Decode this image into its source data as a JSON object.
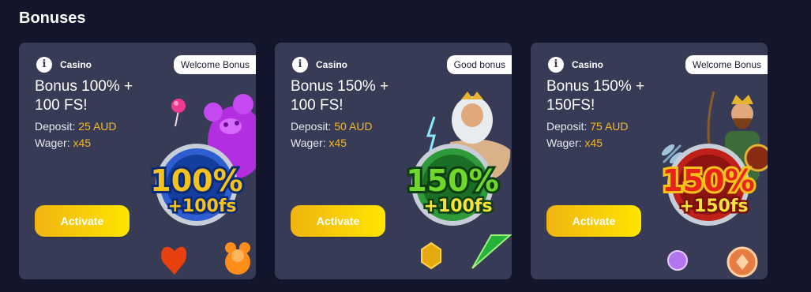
{
  "page": {
    "title": "Bonuses"
  },
  "labels": {
    "deposit": "Deposit: ",
    "wager": "Wager: "
  },
  "cards": [
    {
      "category": "Casino",
      "badge": "Welcome Bonus",
      "title": "Bonus 100% + 100 FS!",
      "deposit": "25 AUD",
      "wager": "x45",
      "button": "Activate",
      "coin_percent": "100%",
      "coin_fs": "+100fs",
      "coin_percent_color": "#f6c21b",
      "coin_ring_color": "#2d5fd0"
    },
    {
      "category": "Casino",
      "badge": "Good bonus",
      "title": "Bonus 150% + 100 FS!",
      "deposit": "50 AUD",
      "wager": "x45",
      "button": "Activate",
      "coin_percent": "150%",
      "coin_fs": "+100fs",
      "coin_percent_color": "#6fd82a",
      "coin_ring_color": "#2f9a3a"
    },
    {
      "category": "Casino",
      "badge": "Welcome Bonus",
      "title": "Bonus 150% + 150FS!",
      "deposit": "75 AUD",
      "wager": "x45",
      "button": "Activate",
      "coin_percent": "150%",
      "coin_fs": "+150fs",
      "coin_percent_color": "#e8241a",
      "coin_ring_color": "#c0201a"
    }
  ],
  "colors": {
    "background": "#13162b",
    "card": "#373b55",
    "accent_value": "#f6b826",
    "button_start": "#f0b412",
    "button_end": "#ffe500"
  },
  "icons": {
    "info": "info-icon",
    "art_1": "gummy-bear-candy-illustration",
    "art_2": "zeus-god-illustration",
    "art_3": "viking-warrior-illustration"
  }
}
